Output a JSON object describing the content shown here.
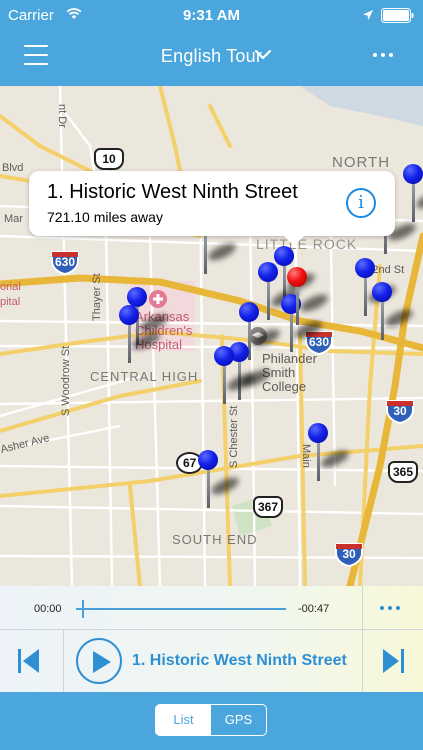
{
  "status": {
    "carrier": "Carrier",
    "time": "9:31 AM",
    "icons": [
      "wifi-icon",
      "location-arrow-icon",
      "battery-icon"
    ]
  },
  "nav": {
    "title": "English Tour",
    "icons": [
      "menu-icon",
      "chevron-down-icon",
      "more-icon"
    ]
  },
  "map": {
    "area_labels": [
      "NORTH",
      "CENTRAL HIGH",
      "SOUTH END",
      "Arkansas Children's Hospital",
      "Philander Smith College",
      "LITTLE ROCK"
    ],
    "street_labels": [
      "Blvd",
      "Mar",
      "Thayer St",
      "S Woodrow St",
      "Asher Ave",
      "S Chester St",
      "Main",
      "E 2nd St",
      "orial",
      "pital",
      "nt Dr"
    ],
    "route_shields": [
      "10",
      "630",
      "630",
      "30",
      "30",
      "67",
      "367",
      "365"
    ],
    "pins": {
      "blue_count": 18,
      "selected_color": "red"
    },
    "colors": {
      "pin_blue": "#1320e8",
      "pin_selected": "#f01010",
      "interstate": "#2f5fb8",
      "highway": "#f2c84b"
    }
  },
  "callout": {
    "title": "1. Historic West Ninth Street",
    "subtitle": "721.10 miles away",
    "icon": "info-icon"
  },
  "player": {
    "elapsed": "00:00",
    "remaining": "-00:47",
    "progress": 0.03,
    "track_title": "1. Historic West Ninth Street",
    "icons": [
      "more-dots-icon",
      "previous-track-icon",
      "play-icon",
      "next-track-icon"
    ]
  },
  "view_toggle": {
    "options": [
      "List",
      "GPS"
    ],
    "selected": "List"
  },
  "colors": {
    "bar_blue": "#4aa6dc",
    "accent_blue": "#2f8fd3"
  }
}
